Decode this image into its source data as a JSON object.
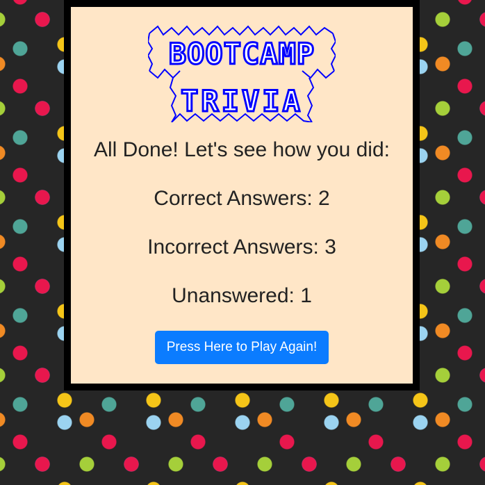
{
  "logo": {
    "line1": "BOOTCAMP",
    "line2": "TRIVIA",
    "color": "#0000ff"
  },
  "results": {
    "heading": "All Done! Let's see how you did:",
    "correct_label": "Correct Answers: ",
    "correct_value": "2",
    "incorrect_label": "Incorrect Answers: ",
    "incorrect_value": "3",
    "unanswered_label": "Unanswered: ",
    "unanswered_value": "1"
  },
  "play_again_button": {
    "label": "Press Here to Play Again!",
    "color": "#0b7cff"
  },
  "background": {
    "base_color": "#262626",
    "dot_colors": [
      "#e8174d",
      "#f5c518",
      "#8a77c8",
      "#9bd3f0",
      "#f08a24",
      "#a5cf3a",
      "#4fa597"
    ]
  }
}
